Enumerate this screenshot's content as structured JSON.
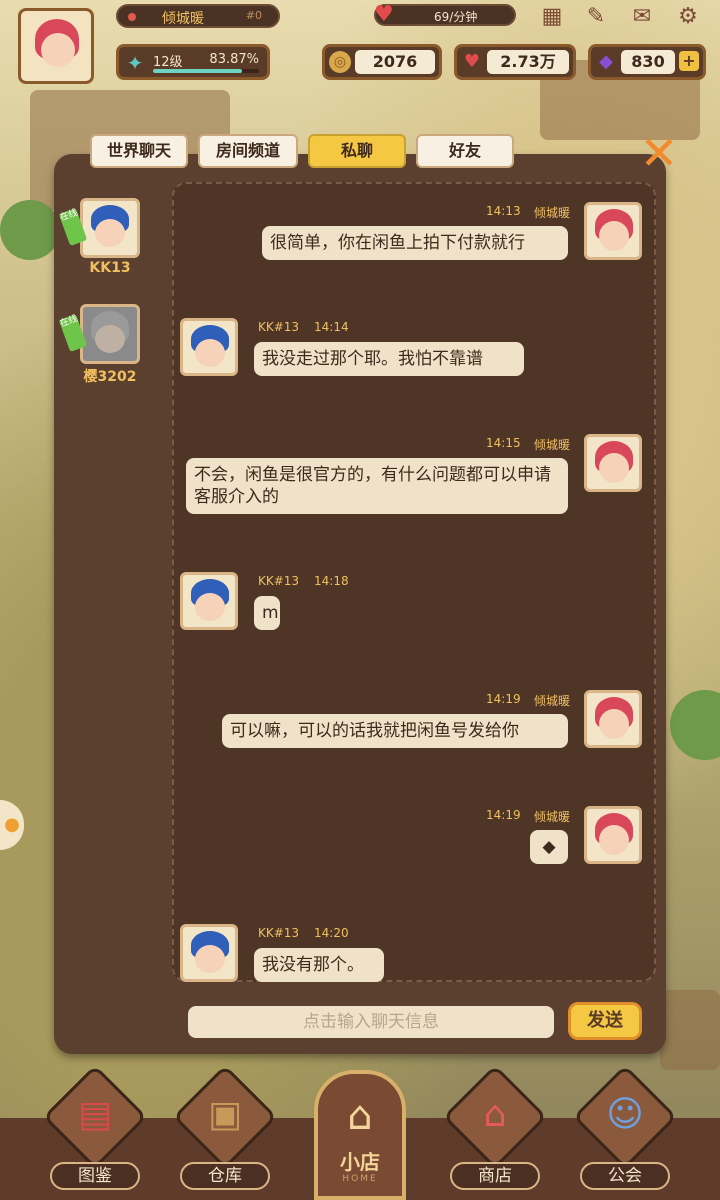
{
  "player": {
    "name": "倾城暖",
    "id": "#0",
    "level": "12级",
    "exp_pct": "83.87%",
    "exp_fraction": 0.8387
  },
  "energy": {
    "rate": "69/分钟"
  },
  "resources": {
    "coins": "2076",
    "hearts": "2.73万",
    "gems": "830"
  },
  "tabs": [
    {
      "label": "世界聊天",
      "active": false
    },
    {
      "label": "房间频道",
      "active": false
    },
    {
      "label": "私聊",
      "active": true
    },
    {
      "label": "好友",
      "active": false
    }
  ],
  "contacts": [
    {
      "name": "KK13",
      "badge": "在线"
    },
    {
      "name": "樱3202",
      "badge": "在线"
    }
  ],
  "messages": [
    {
      "side": "right",
      "sender": "倾城暖",
      "time": "14:13",
      "text": "很简单，你在闲鱼上拍下付款就行"
    },
    {
      "side": "left",
      "sender": "KK#13",
      "time": "14:14",
      "text": "我没走过那个耶。我怕不靠谱"
    },
    {
      "side": "right",
      "sender": "倾城暖",
      "time": "14:15",
      "text": "不会，闲鱼是很官方的，有什么问题都可以申请客服介入的"
    },
    {
      "side": "left",
      "sender": "KK#13",
      "time": "14:18",
      "text": "m"
    },
    {
      "side": "right",
      "sender": "倾城暖",
      "time": "14:19",
      "text": "可以嘛，可以的话我就把闲鱼号发给你"
    },
    {
      "side": "right",
      "sender": "倾城暖",
      "time": "14:19",
      "text": "◆"
    },
    {
      "side": "left",
      "sender": "KK#13",
      "time": "14:20",
      "text": "我没有那个。"
    }
  ],
  "input": {
    "placeholder": "点击输入聊天信息",
    "send_label": "发送"
  },
  "nav": [
    {
      "label": "图鉴",
      "icon": "book-icon"
    },
    {
      "label": "仓库",
      "icon": "box-icon"
    },
    {
      "label": "小店",
      "sub": "HOME",
      "icon": "house-icon"
    },
    {
      "label": "商店",
      "icon": "shop-icon"
    },
    {
      "label": "公会",
      "icon": "guild-icon"
    }
  ]
}
